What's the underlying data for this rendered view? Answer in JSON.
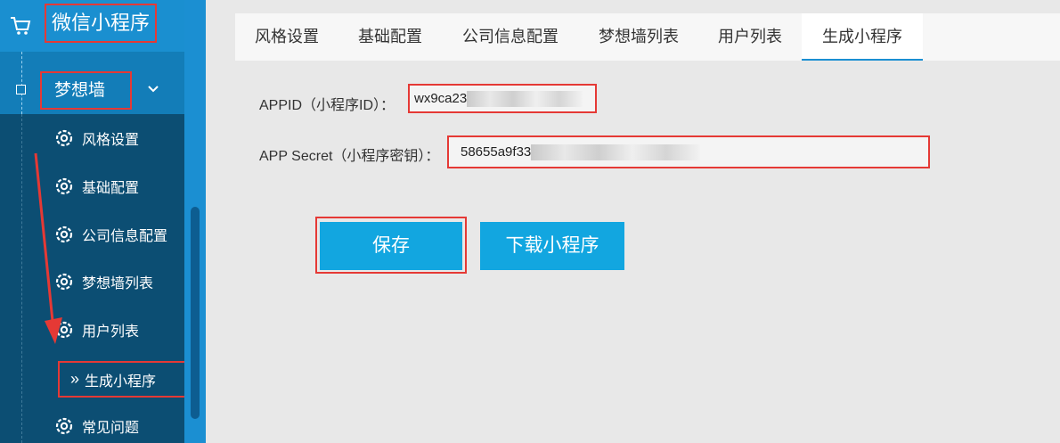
{
  "brand": {
    "title": "微信小程序",
    "icon": "cart-icon"
  },
  "menu": {
    "header": "梦想墙"
  },
  "sidebar": {
    "items": [
      {
        "label": "风格设置",
        "icon": "gear-icon"
      },
      {
        "label": "基础配置",
        "icon": "gear-icon"
      },
      {
        "label": "公司信息配置",
        "icon": "gear-icon"
      },
      {
        "label": "梦想墙列表",
        "icon": "gear-icon"
      },
      {
        "label": "用户列表",
        "icon": "gear-icon"
      },
      {
        "label": "生成小程序",
        "icon": "double-chevron-right-icon",
        "active": true
      },
      {
        "label": "常见问题",
        "icon": "gear-icon"
      }
    ]
  },
  "tabs": [
    {
      "label": "风格设置"
    },
    {
      "label": "基础配置"
    },
    {
      "label": "公司信息配置"
    },
    {
      "label": "梦想墙列表"
    },
    {
      "label": "用户列表"
    },
    {
      "label": "生成小程序",
      "active": true
    }
  ],
  "form": {
    "appid_label": "APPID（小程序ID）：",
    "appid_value": "wx9ca23",
    "secret_label": "APP Secret（小程序密钥）：",
    "secret_value": "58655a9f33"
  },
  "buttons": {
    "save": "保存",
    "download": "下载小程序"
  },
  "colors": {
    "accent": "#12a6e0",
    "sidebar": "#0c4e73",
    "highlight": "#e53935"
  }
}
